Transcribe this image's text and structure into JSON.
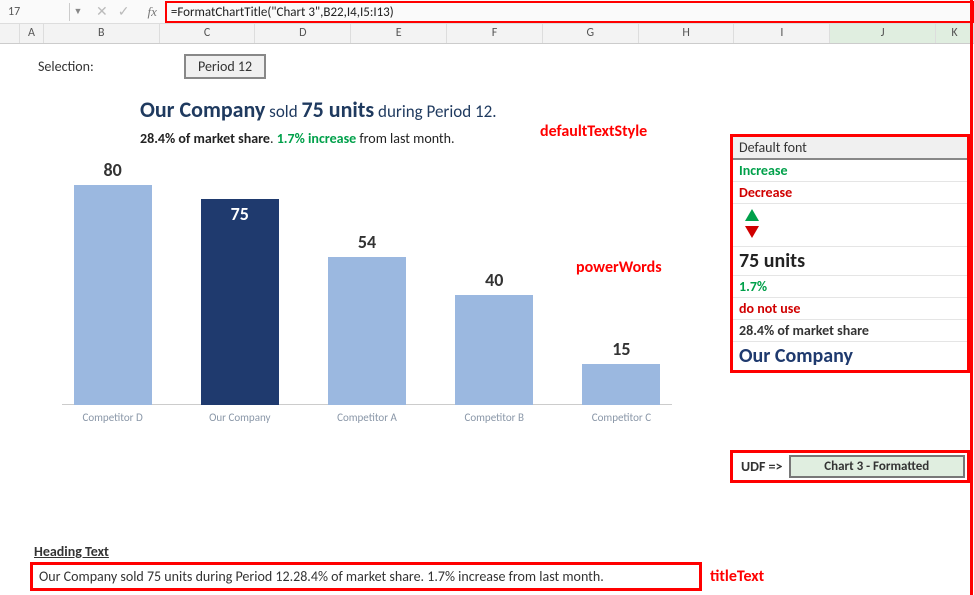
{
  "formula_bar": {
    "name_box": "17",
    "formula": "=FormatChartTitle(\"Chart 3\",B22,I4,I5:I13)"
  },
  "columns": [
    "A",
    "B",
    "C",
    "D",
    "E",
    "F",
    "G",
    "H",
    "I",
    "J",
    "K"
  ],
  "selection": {
    "label": "Selection:",
    "value": "Period 12"
  },
  "chart_title": {
    "company": "Our Company",
    "sold_word": " sold ",
    "units": "75 units",
    "during": " during Period 12.",
    "share": "28.4% of market share",
    "sep": ". ",
    "increase": "1.7% increase",
    "tail": " from last month."
  },
  "chart_data": {
    "type": "bar",
    "categories": [
      "Competitor D",
      "Our Company",
      "Competitor A",
      "Competitor B",
      "Competitor C"
    ],
    "values": [
      80,
      75,
      54,
      40,
      15
    ],
    "highlight_index": 1,
    "title": "Our Company sold 75 units during Period 12. 28.4% of market share. 1.7% increase from last month.",
    "xlabel": "",
    "ylabel": "",
    "ylim": [
      0,
      80
    ]
  },
  "annotations": {
    "defaultTextStyle": "defaultTextStyle",
    "powerWords": "powerWords",
    "titleText": "titleText"
  },
  "side": {
    "header": "Default font",
    "increase": "Increase",
    "decrease": "Decrease",
    "units": "75 units",
    "pct": "1.7%",
    "donot": "do not use",
    "share": "28.4% of market share",
    "company": "Our Company"
  },
  "udf": {
    "label": "UDF =>",
    "value": "Chart 3 - Formatted"
  },
  "bottom": {
    "heading": "Heading Text",
    "titleText": "Our Company sold 75 units during Period 12.28.4% of market share. 1.7% increase from last month."
  }
}
